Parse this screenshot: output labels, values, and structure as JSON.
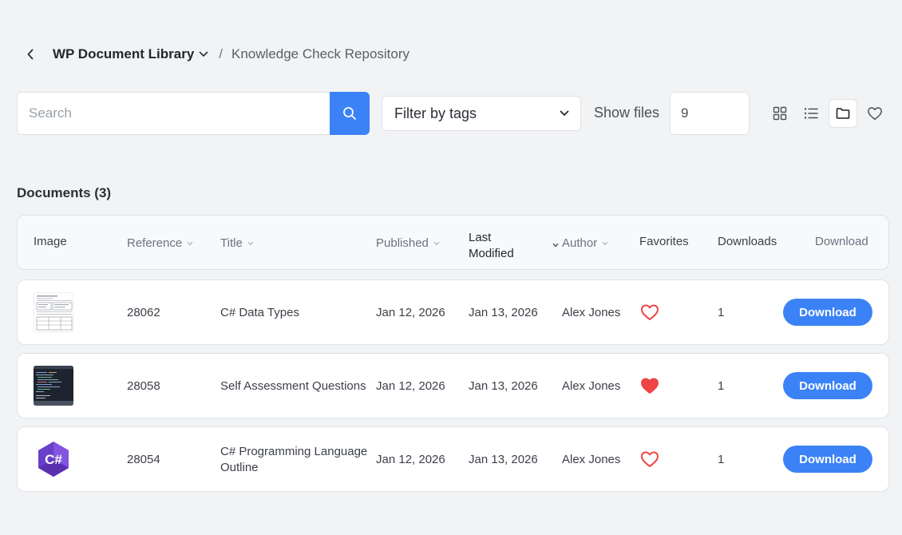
{
  "breadcrumb": {
    "root": "WP Document Library",
    "separator": "/",
    "current": "Knowledge Check Repository"
  },
  "toolbar": {
    "search_placeholder": "Search",
    "filter_tags_label": "Filter by tags",
    "show_files_label": "Show files",
    "show_files_value": "9",
    "views": [
      "grid-view-icon",
      "list-view-icon",
      "folder-view-icon",
      "favorites-view-icon"
    ],
    "active_view": "folder-view-icon"
  },
  "documents": {
    "title": "Documents (3)",
    "columns": {
      "image": "Image",
      "reference": "Reference",
      "title": "Title",
      "published": "Published",
      "last_modified_line1": "Last",
      "last_modified_line2": "Modified",
      "author": "Author",
      "favorites": "Favorites",
      "downloads": "Downloads",
      "download": "Download"
    },
    "rows": [
      {
        "reference": "28062",
        "title_line1": "C# Data Types",
        "title_line2": "",
        "published": "Jan 12, 2026",
        "modified": "Jan 13, 2026",
        "author": "Alex Jones",
        "favorite": false,
        "downloads": "1",
        "button": "Download",
        "thumbnail": "document-thumbnail"
      },
      {
        "reference": "28058",
        "title_line1": "Self Assessment Questions",
        "title_line2": "",
        "published": "Jan 12, 2026",
        "modified": "Jan 13, 2026",
        "author": "Alex Jones",
        "favorite": true,
        "downloads": "1",
        "button": "Download",
        "thumbnail": "code-screenshot-thumbnail"
      },
      {
        "reference": "28054",
        "title_line1": "C# Programming Language",
        "title_line2": "Outline",
        "published": "Jan 12, 2026",
        "modified": "Jan 13, 2026",
        "author": "Alex Jones",
        "favorite": false,
        "downloads": "1",
        "button": "Download",
        "thumbnail": "csharp-logo-thumbnail",
        "logo_text": "C#"
      }
    ]
  },
  "colors": {
    "accent": "#3b82f6",
    "heart": "#ef4444",
    "background": "#f2f3f5"
  }
}
